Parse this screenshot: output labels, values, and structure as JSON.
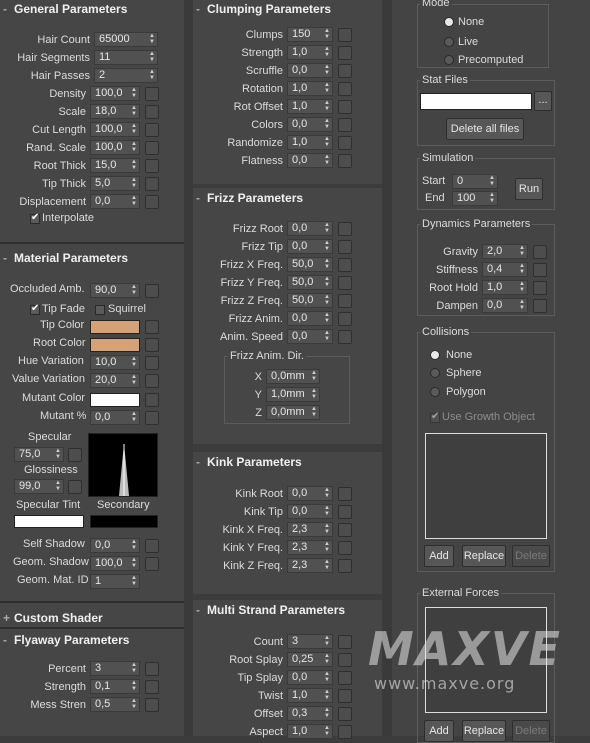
{
  "general": {
    "title": "General Parameters",
    "rows": [
      {
        "label": "Hair Count",
        "value": "65000"
      },
      {
        "label": "Hair Segments",
        "value": "11"
      },
      {
        "label": "Hair Passes",
        "value": "2"
      },
      {
        "label": "Density",
        "value": "100,0"
      },
      {
        "label": "Scale",
        "value": "18,0"
      },
      {
        "label": "Cut Length",
        "value": "100,0"
      },
      {
        "label": "Rand. Scale",
        "value": "100,0"
      },
      {
        "label": "Root Thick",
        "value": "15,0"
      },
      {
        "label": "Tip Thick",
        "value": "5,0"
      },
      {
        "label": "Displacement",
        "value": "0,0"
      }
    ],
    "interpolate": "Interpolate"
  },
  "material": {
    "title": "Material Parameters",
    "occluded_label": "Occluded Amb.",
    "occluded_value": "90,0",
    "tip_fade": "Tip Fade",
    "squirrel": "Squirrel",
    "tip_color_label": "Tip Color",
    "root_color_label": "Root Color",
    "tip_color": "#d4a276",
    "root_color": "#d4a276",
    "hue_label": "Hue Variation",
    "hue_value": "10,0",
    "value_var_label": "Value Variation",
    "value_var_value": "20,0",
    "mutant_color_label": "Mutant Color",
    "mutant_color": "#ffffff",
    "mutant_pct_label": "Mutant %",
    "mutant_pct_value": "0,0",
    "specular_label": "Specular",
    "specular_value": "75,0",
    "glossiness_label": "Glossiness",
    "glossiness_value": "99,0",
    "spec_tint_label": "Specular Tint",
    "secondary_label": "Secondary",
    "spec_tint": "#ffffff",
    "secondary": "#000000",
    "self_shadow_label": "Self Shadow",
    "self_shadow_value": "0,0",
    "geom_shadow_label": "Geom. Shadow",
    "geom_shadow_value": "100,0",
    "geom_mat_label": "Geom. Mat. ID",
    "geom_mat_value": "1"
  },
  "custom_shader": {
    "title": "Custom Shader"
  },
  "flyaway": {
    "title": "Flyaway Parameters",
    "rows": [
      {
        "label": "Percent",
        "value": "3"
      },
      {
        "label": "Strength",
        "value": "0,1"
      },
      {
        "label": "Mess Stren",
        "value": "0,5"
      }
    ]
  },
  "clumping": {
    "title": "Clumping Parameters",
    "rows": [
      {
        "label": "Clumps",
        "value": "150"
      },
      {
        "label": "Strength",
        "value": "1,0"
      },
      {
        "label": "Scruffle",
        "value": "0,0"
      },
      {
        "label": "Rotation",
        "value": "1,0"
      },
      {
        "label": "Rot Offset",
        "value": "1,0"
      },
      {
        "label": "Colors",
        "value": "0,0"
      },
      {
        "label": "Randomize",
        "value": "1,0"
      },
      {
        "label": "Flatness",
        "value": "0,0"
      }
    ]
  },
  "frizz": {
    "title": "Frizz Parameters",
    "rows": [
      {
        "label": "Frizz Root",
        "value": "0,0"
      },
      {
        "label": "Frizz Tip",
        "value": "0,0"
      },
      {
        "label": "Frizz X Freq.",
        "value": "50,0"
      },
      {
        "label": "Frizz Y Freq.",
        "value": "50,0"
      },
      {
        "label": "Frizz Z Freq.",
        "value": "50,0"
      },
      {
        "label": "Frizz Anim.",
        "value": "0,0"
      },
      {
        "label": "Anim. Speed",
        "value": "0,0"
      }
    ],
    "dir_title": "Frizz Anim. Dir.",
    "dir": [
      {
        "label": "X",
        "value": "0,0mm"
      },
      {
        "label": "Y",
        "value": "1,0mm"
      },
      {
        "label": "Z",
        "value": "0,0mm"
      }
    ]
  },
  "kink": {
    "title": "Kink Parameters",
    "rows": [
      {
        "label": "Kink Root",
        "value": "0,0"
      },
      {
        "label": "Kink Tip",
        "value": "0,0"
      },
      {
        "label": "Kink X Freq.",
        "value": "2,3"
      },
      {
        "label": "Kink Y Freq.",
        "value": "2,3"
      },
      {
        "label": "Kink Z Freq.",
        "value": "2,3"
      }
    ]
  },
  "multi": {
    "title": "Multi Strand Parameters",
    "rows": [
      {
        "label": "Count",
        "value": "3"
      },
      {
        "label": "Root Splay",
        "value": "0,25"
      },
      {
        "label": "Tip Splay",
        "value": "0,0"
      },
      {
        "label": "Twist",
        "value": "1,0"
      },
      {
        "label": "Offset",
        "value": "0,3"
      },
      {
        "label": "Aspect",
        "value": "1,0"
      }
    ]
  },
  "dynamics": {
    "mode_title": "Mode",
    "modes": [
      "None",
      "Live",
      "Precomputed"
    ],
    "stat_title": "Stat Files",
    "browse": "...",
    "delete_all": "Delete all files",
    "sim_title": "Simulation",
    "start_label": "Start",
    "start_value": "0",
    "end_label": "End",
    "end_value": "100",
    "run": "Run",
    "dyn_title": "Dynamics Parameters",
    "dyn_rows": [
      {
        "label": "Gravity",
        "value": "2,0"
      },
      {
        "label": "Stiffness",
        "value": "0,4"
      },
      {
        "label": "Root Hold",
        "value": "1,0"
      },
      {
        "label": "Dampen",
        "value": "0,0"
      }
    ],
    "coll_title": "Collisions",
    "collisions": [
      "None",
      "Sphere",
      "Polygon"
    ],
    "use_growth": "Use Growth Object",
    "add": "Add",
    "replace": "Replace",
    "delete": "Delete",
    "ext_title": "External Forces"
  },
  "watermark": {
    "logo": "MAXVE",
    "url": "www.maxve.org"
  }
}
